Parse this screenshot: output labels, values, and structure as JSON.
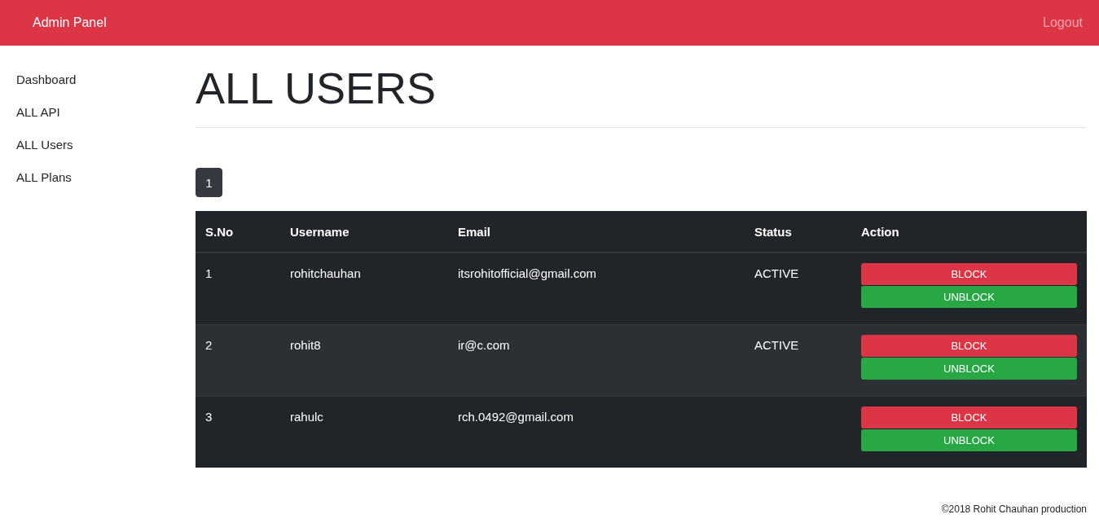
{
  "navbar": {
    "brand": "Admin Panel",
    "logout": "Logout"
  },
  "sidebar": {
    "items": [
      {
        "label": "Dashboard"
      },
      {
        "label": "ALL API"
      },
      {
        "label": "ALL Users"
      },
      {
        "label": "ALL Plans"
      }
    ]
  },
  "page_title": "ALL USERS",
  "pagination": [
    {
      "label": "1",
      "selected": true
    }
  ],
  "table": {
    "columns": [
      "S.No",
      "Username",
      "Email",
      "Status",
      "Action"
    ],
    "rows": [
      {
        "sno": "1",
        "username": "rohitchauhan",
        "email": "itsrohitofficial@gmail.com",
        "status": "ACTIVE",
        "actions": [
          {
            "kind": "block",
            "label": "BLOCK"
          },
          {
            "kind": "unblock",
            "label": "UNBLOCK"
          }
        ]
      },
      {
        "sno": "2",
        "username": "rohit8",
        "email": "ir@c.com",
        "status": "ACTIVE",
        "actions": [
          {
            "kind": "block",
            "label": "BLOCK"
          },
          {
            "kind": "unblock",
            "label": "UNBLOCK"
          }
        ]
      },
      {
        "sno": "3",
        "username": "rahulc",
        "email": "rch.0492@gmail.com",
        "actions": [
          {
            "kind": "block",
            "label": "BLOCK"
          },
          {
            "kind": "unblock",
            "label": "UNBLOCK"
          }
        ]
      }
    ]
  },
  "footer": "©2018 Rohit Chauhan production"
}
